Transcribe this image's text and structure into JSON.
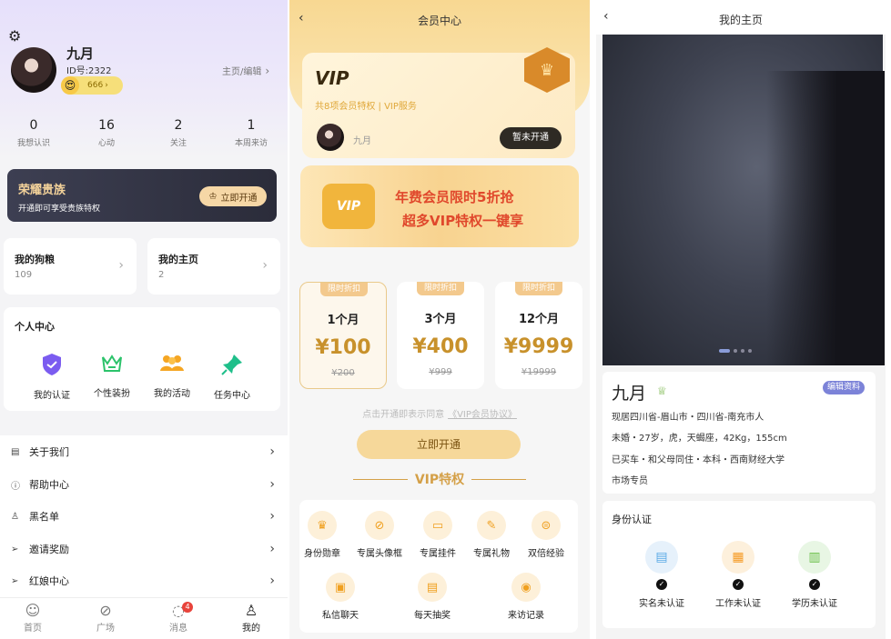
{
  "profile": {
    "name": "九月",
    "id": "ID号:2322",
    "badge_value": "666",
    "home_edit": "主页/编辑",
    "stats": [
      {
        "n": "0",
        "l": "我想认识"
      },
      {
        "n": "16",
        "l": "心动"
      },
      {
        "n": "2",
        "l": "关注"
      },
      {
        "n": "1",
        "l": "本周来访"
      }
    ],
    "noble": {
      "title": "荣耀贵族",
      "sub": "开通即可享受贵族特权",
      "btn": "立即开通"
    },
    "cards": [
      {
        "title": "我的狗粮",
        "value": "109"
      },
      {
        "title": "我的主页",
        "value": "2"
      }
    ],
    "personal": {
      "title": "个人中心",
      "items": [
        {
          "label": "我的认证",
          "icon": "shield-icon",
          "color": "#7b5cf0"
        },
        {
          "label": "个性装扮",
          "icon": "crown-icon",
          "color": "#2cc36b"
        },
        {
          "label": "我的活动",
          "icon": "group-icon",
          "color": "#f5a623"
        },
        {
          "label": "任务中心",
          "icon": "pin-icon",
          "color": "#1fbf8a"
        }
      ]
    },
    "menu": [
      {
        "label": "关于我们",
        "icon": "▤"
      },
      {
        "label": "帮助中心",
        "icon": "?"
      },
      {
        "label": "黑名单",
        "icon": "⚲"
      },
      {
        "label": "邀请奖励",
        "icon": "➤"
      },
      {
        "label": "红娘中心",
        "icon": "➤"
      }
    ],
    "tabs": [
      {
        "label": "首页",
        "icon": "☺"
      },
      {
        "label": "广场",
        "icon": "⊘"
      },
      {
        "label": "消息",
        "icon": "◌",
        "badge": "4"
      },
      {
        "label": "我的",
        "icon": "♙"
      }
    ]
  },
  "vip": {
    "title": "会员中心",
    "logo": "VIP",
    "sub": "共8项会员特权 | VIP服务",
    "user": "九月",
    "status": "暂未开通",
    "banner_l1": "年费会员限时5折抢",
    "banner_l2": "超多VIP特权一键享",
    "plans": [
      {
        "tag": "限时折扣",
        "months": "1个月",
        "price": "¥100",
        "orig": "¥200"
      },
      {
        "tag": "限时折扣",
        "months": "3个月",
        "price": "¥400",
        "orig": "¥999"
      },
      {
        "tag": "限时折扣",
        "months": "12个月",
        "price": "¥9999",
        "orig": "¥19999"
      }
    ],
    "agree": "点击开通即表示同意",
    "agreement": "《VIP会员协议》",
    "open_btn": "立即开通",
    "perk_title": "VIP特权",
    "perks": [
      {
        "label": "身份勋章",
        "icon": "♛"
      },
      {
        "label": "专属头像框",
        "icon": "⊘"
      },
      {
        "label": "专属挂件",
        "icon": "▭"
      },
      {
        "label": "专属礼物",
        "icon": "✎"
      },
      {
        "label": "双倍经验",
        "icon": "⊜"
      },
      {
        "label": "私信聊天",
        "icon": "▣"
      },
      {
        "label": "每天抽奖",
        "icon": "▤"
      },
      {
        "label": "来访记录",
        "icon": "◉"
      }
    ]
  },
  "home": {
    "title": "我的主页",
    "name": "九月",
    "edit": "编辑资料",
    "lines": [
      "现居四川省-眉山市・四川省-南充市人",
      "未婚・27岁，虎，天蝎座，42Kg，155cm",
      "已买车・和父母同住・本科・西南财经大学",
      "市场专员"
    ],
    "cert_title": "身份认证",
    "certs": [
      {
        "label": "实名未认证",
        "bg": "#e6f1fb",
        "color": "#5aa9e6",
        "icon": "▤"
      },
      {
        "label": "工作未认证",
        "bg": "#fdf0dc",
        "color": "#f59a23",
        "icon": "▦"
      },
      {
        "label": "学历未认证",
        "bg": "#e8f6e4",
        "color": "#6cc04a",
        "icon": "▥"
      }
    ]
  }
}
